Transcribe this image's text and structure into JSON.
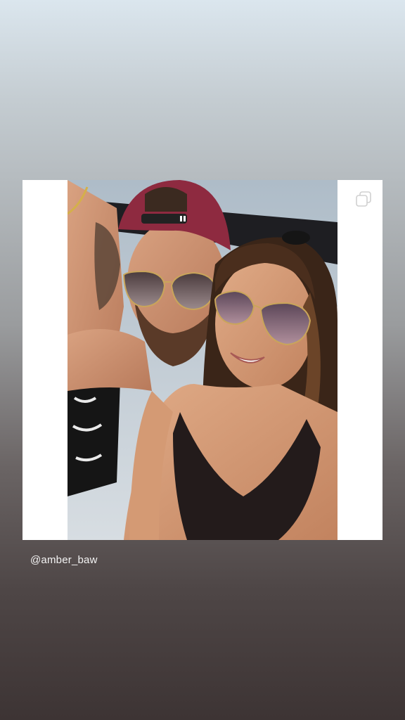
{
  "story": {
    "mention": "@amber_baw"
  },
  "post": {
    "photo_description_icon": "multiple-photos-icon"
  },
  "colors": {
    "background_top": "#dbe6ee",
    "background_bottom": "#3d3434",
    "card_background": "#ffffff",
    "caption_text": "#f4f4f4"
  }
}
